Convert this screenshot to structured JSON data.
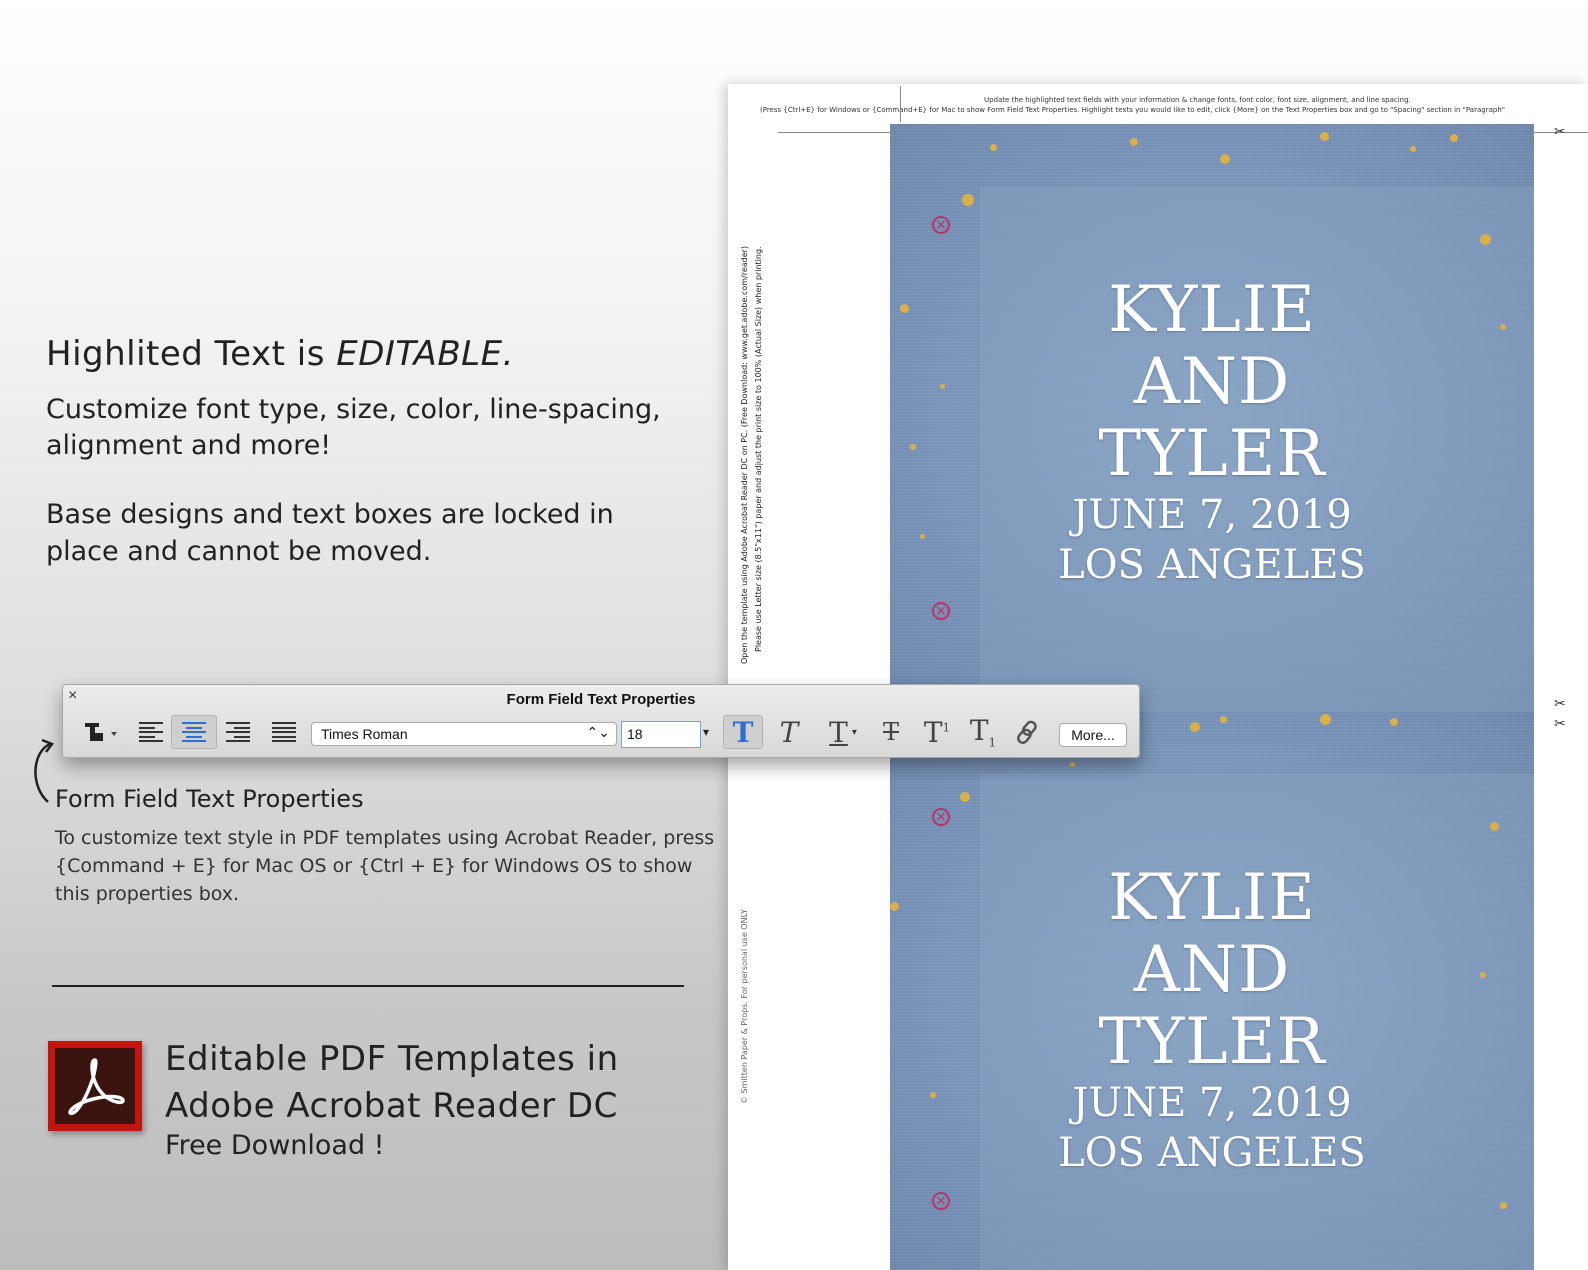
{
  "left": {
    "headline_part1": "Highlited Text is ",
    "headline_part2": "EDITABLE.",
    "para1": "Customize font type, size, color, line-spacing, alignment and more!",
    "para2": "Base designs and text boxes are locked in place and  cannot be moved.",
    "ffp_heading": "Form Field Text Properties",
    "ffp_desc": "To customize text style in PDF templates using Acrobat Reader, press {Command + E} for Mac OS or {Ctrl + E} for Windows OS to show this properties box.",
    "promo_title_line1": "Editable PDF Templates in",
    "promo_title_line2": "Adobe Acrobat Reader DC",
    "promo_sub": "Free Download !"
  },
  "toolbar": {
    "close": "×",
    "title": "Form Field Text Properties",
    "font": "Times Roman",
    "font_chevron": "⌃⌄",
    "size": "18",
    "more_label": "More...",
    "active_alignment": "center",
    "bold_active": true
  },
  "document": {
    "note_line1": "Update the highlighted text fields with your information & change fonts, font color, font size, alignment, and line spacing.",
    "note_line2": "(Press {Ctrl+E} for Windows or {Command+E} for Mac to show Form Field Text Properties.  Highlight texts you would like to edit, click {More} on the Text Properties box and go to \"Spacing\" section in \"Paragraph\"",
    "side_note1": "Open the template using Adobe Acrobat Reader DC on PC. (Free Download: www.get.adobe.com/reader)",
    "side_note2": "Please use Letter size (8.5\"x11\") paper and adjust the print size to 100% (Actual Size) when printing.",
    "copyright": "© Smitten Paper & Props. For personal use ONLY",
    "cards": [
      {
        "line1": "KYLIE",
        "line2": "AND",
        "line3": "TYLER",
        "date": "JUNE 7, 2019",
        "place": "LOS ANGELES"
      },
      {
        "line1": "KYLIE",
        "line2": "AND",
        "line3": "TYLER",
        "date": "JUNE 7, 2019",
        "place": "LOS ANGELES"
      }
    ]
  },
  "colors": {
    "denim": "#7d98bd",
    "gold_flecks": "#d9b04a",
    "registration_marks": "#c0306a",
    "acrobat_red": "#c0160e",
    "active_blue": "#2f6fd0"
  }
}
